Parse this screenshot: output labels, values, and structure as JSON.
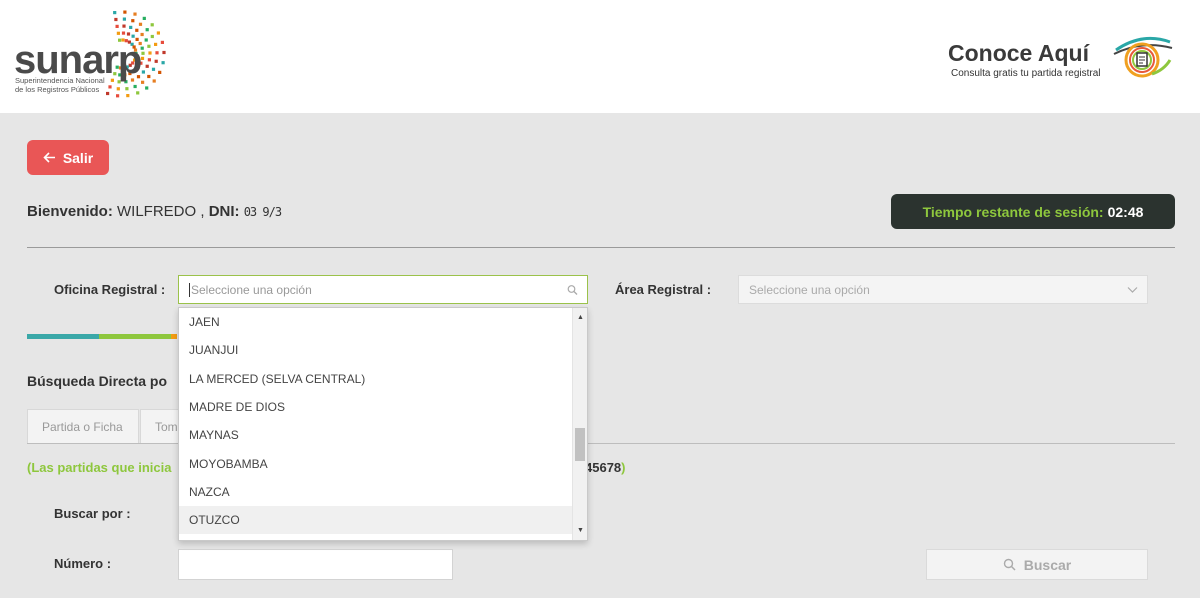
{
  "header": {
    "logo_word": "sunarp",
    "logo_sub_line1": "Superintendencia Nacional",
    "logo_sub_line2": "de los Registros Públicos",
    "conoce_title": "Conoce Aquí",
    "conoce_sub": "Consulta gratis tu partida registral"
  },
  "exit_button": {
    "label": "Salir"
  },
  "welcome": {
    "label": "Bienvenido:",
    "name": "WILFREDO ,",
    "dni_label": "DNI:",
    "dni_value": "03 9/3"
  },
  "session": {
    "label": "Tiempo restante de sesión:",
    "value": "02:48"
  },
  "form": {
    "oficina_label": "Oficina Registral :",
    "oficina_placeholder": "Seleccione una opción",
    "area_label": "Área Registral :",
    "area_placeholder": "Seleccione una opción",
    "buscar_por_label": "Buscar por :",
    "numero_label": "Número :",
    "buscar_button": "Buscar"
  },
  "section_title": "Búsqueda Directa po",
  "tabs": [
    "Partida o Ficha",
    "Tom"
  ],
  "note": {
    "start": "(Las partidas que inicia",
    "end_digits": "45678",
    "end_paren": ")"
  },
  "dropdown": {
    "items": [
      "JAEN",
      "JUANJUI",
      "LA MERCED (SELVA CENTRAL)",
      "MADRE DE DIOS",
      "MAYNAS",
      "MOYOBAMBA",
      "NAZCA",
      "OTUZCO"
    ],
    "hover_index": 7
  },
  "colors": {
    "accent_green": "#8ec73d",
    "exit_red": "#e95656",
    "timer_bg": "#2b332f",
    "bar_teal": "#3aa8a8",
    "bar_green": "#8ec73d",
    "bar_orange": "#f39c12"
  }
}
